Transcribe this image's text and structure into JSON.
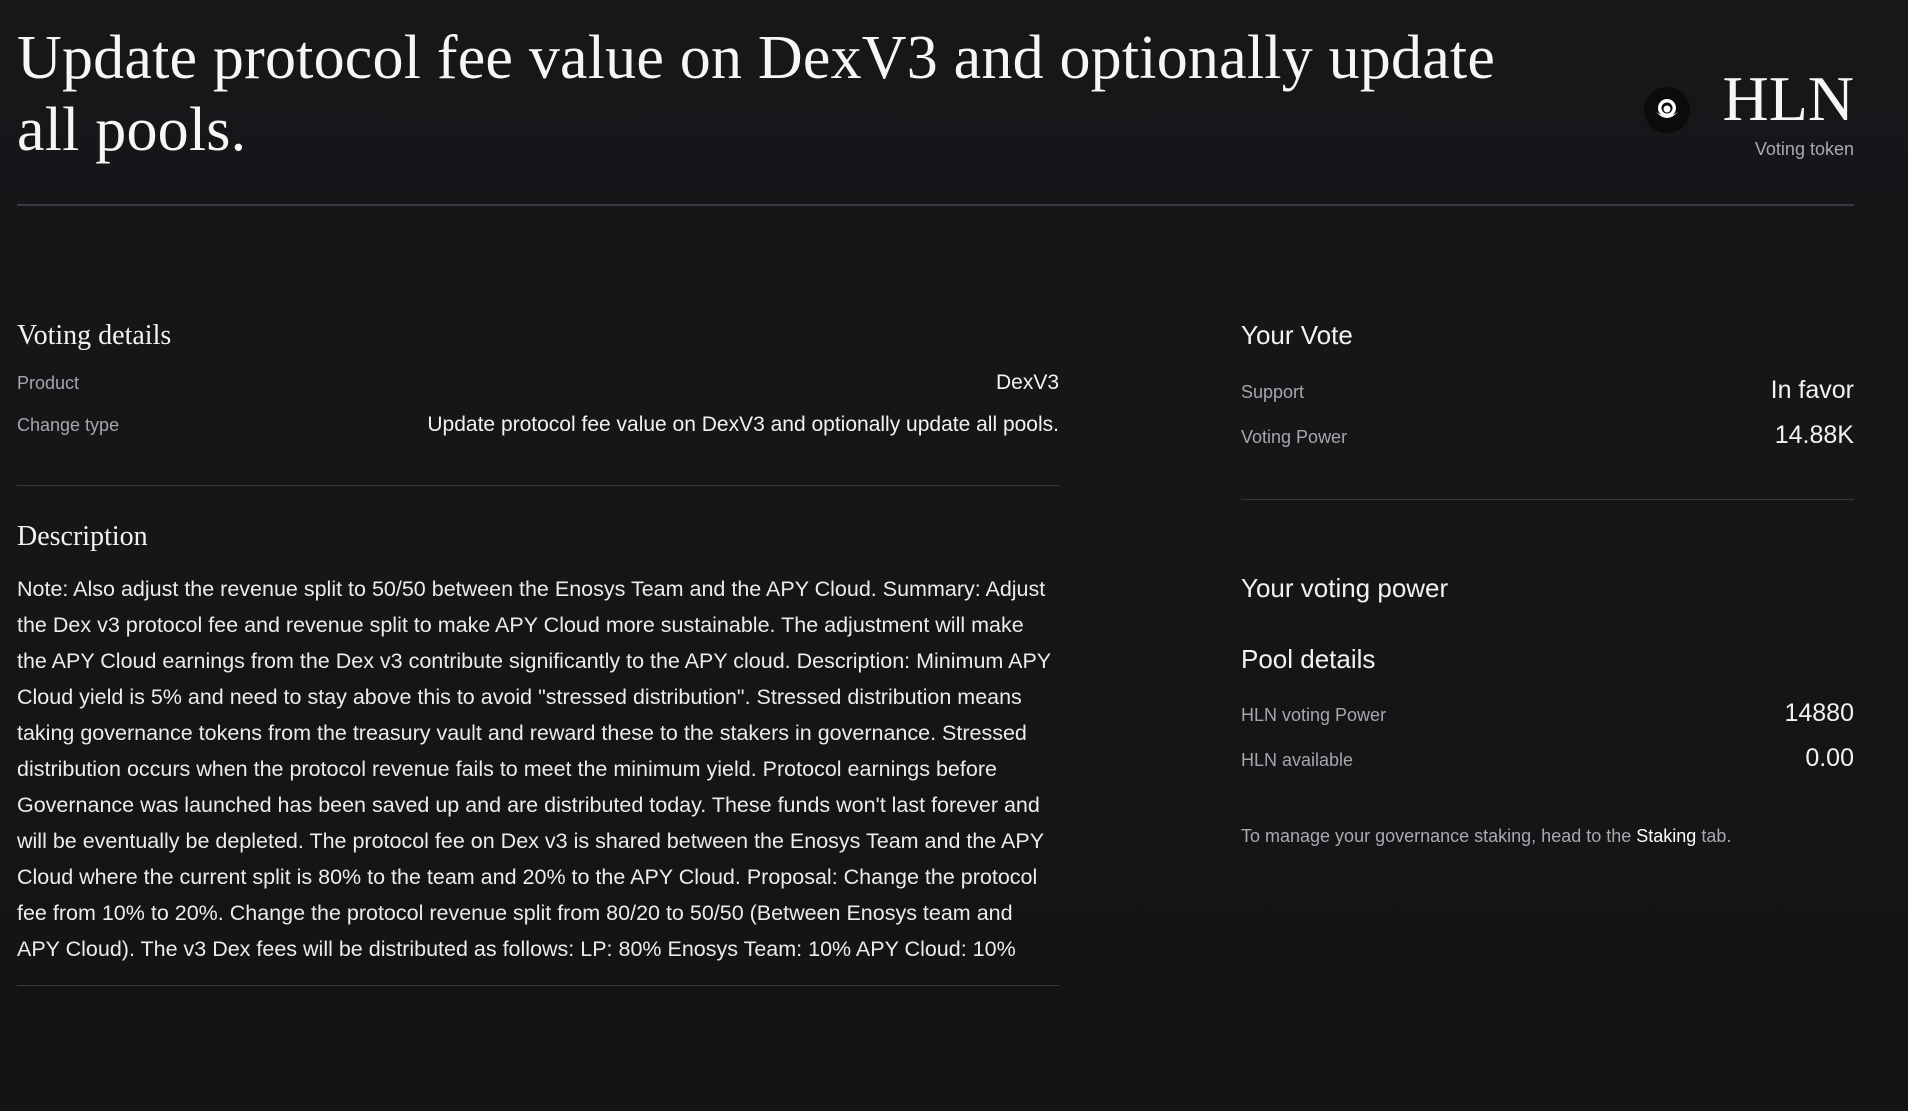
{
  "header": {
    "title": "Update protocol fee value on DexV3 and optionally update all pools.",
    "token_symbol": "HLN",
    "token_caption": "Voting token",
    "token_icon": "hln-token-icon"
  },
  "voting_details": {
    "heading": "Voting details",
    "rows": [
      {
        "label": "Product",
        "value": "DexV3"
      },
      {
        "label": "Change type",
        "value": "Update protocol fee value on DexV3 and optionally update all pools."
      }
    ]
  },
  "description": {
    "heading": "Description",
    "text": "Note: Also adjust the revenue split to 50/50 between the Enosys Team and the APY Cloud. Summary: Adjust the Dex v3 protocol fee and revenue split to make APY Cloud more sustainable. The adjustment will make the APY Cloud earnings from the Dex v3 contribute significantly to the APY cloud. Description: Minimum APY Cloud yield is 5% and need to stay above this to avoid \"stressed distribution\". Stressed distribution means taking governance tokens from the treasury vault and reward these to the stakers in governance. Stressed distribution occurs when the protocol revenue fails to meet the minimum yield. Protocol earnings before Governance was launched has been saved up and are distributed today. These funds won't last forever and will be eventually be depleted. The protocol fee on Dex v3 is shared between the Enosys Team and the APY Cloud where the current split is 80% to the team and 20% to the APY Cloud. Proposal: Change the protocol fee from 10% to 20%. Change the protocol revenue split from 80/20 to 50/50 (Between Enosys team and APY Cloud). The v3 Dex fees will be distributed as follows: LP: 80% Enosys Team: 10% APY Cloud: 10%"
  },
  "your_vote": {
    "heading": "Your Vote",
    "rows": [
      {
        "label": "Support",
        "value": "In favor"
      },
      {
        "label": "Voting Power",
        "value": "14.88K"
      }
    ]
  },
  "your_voting_power": {
    "heading": "Your voting power"
  },
  "pool_details": {
    "heading": "Pool details",
    "rows": [
      {
        "label": "HLN voting Power",
        "value": "14880"
      },
      {
        "label": "HLN available",
        "value": "0.00"
      }
    ]
  },
  "staking_note": {
    "prefix": "To manage your governance staking, head to the",
    "link": "Staking",
    "suffix": "tab."
  },
  "colors": {
    "background": "#161618",
    "text_primary": "#f2f2f2",
    "text_secondary": "#a6a6ab",
    "divider": "#38383c"
  }
}
